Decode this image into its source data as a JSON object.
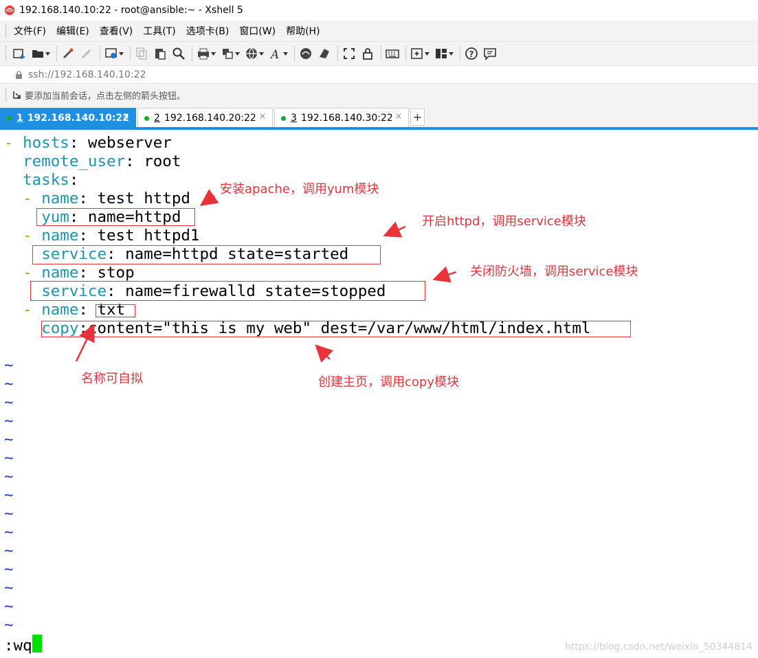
{
  "window": {
    "title": "192.168.140.10:22 - root@ansible:~ - Xshell 5"
  },
  "menu": [
    "文件(F)",
    "编辑(E)",
    "查看(V)",
    "工具(T)",
    "选项卡(B)",
    "窗口(W)",
    "帮助(H)"
  ],
  "toolbar": {
    "icons": [
      "new-session-icon",
      "open-folder-icon",
      "connect-icon",
      "disconnect-icon",
      "properties-icon",
      "copy-icon",
      "paste-icon",
      "find-icon",
      "print-icon",
      "transfer-icon",
      "globe-icon",
      "font-icon",
      "xftp-icon",
      "xmanager-icon",
      "fullscreen-icon",
      "lock-icon",
      "keyboard-icon",
      "add-tab-icon",
      "layout-icon",
      "help-icon",
      "chat-icon"
    ]
  },
  "address": {
    "text": "ssh://192.168.140.10:22"
  },
  "session_hint": {
    "text": "要添加当前会话，点击左侧的箭头按钮。"
  },
  "tabs": [
    {
      "num": "1",
      "label": "192.168.140.10:22",
      "active": true
    },
    {
      "num": "2",
      "label": "192.168.140.20:22",
      "active": false
    },
    {
      "num": "3",
      "label": "192.168.140.30:22",
      "active": false
    }
  ],
  "colors": {
    "accent": "#1e8fe1",
    "keyword": "#1a95b0",
    "dash": "#b5a21d",
    "annotation": "#e8333a",
    "tilde": "#1a3cbf",
    "cursor": "#00e000",
    "status_dot": "#0fae1e"
  },
  "editor": {
    "lines": [
      {
        "dash": "- ",
        "key": "hosts",
        "colon": ": ",
        "value": "webserver"
      },
      {
        "dash": "",
        "key": "remote_user",
        "colon": ": ",
        "value": "root"
      },
      {
        "dash": "",
        "key": "tasks",
        "colon": ":",
        "value": ""
      },
      {
        "dash": "- ",
        "key": "name",
        "colon": ": ",
        "value": "test httpd"
      },
      {
        "dash": "",
        "key": "yum",
        "colon": ": ",
        "value": "name=httpd"
      },
      {
        "dash": "- ",
        "key": "name",
        "colon": ": ",
        "value": "test httpd1"
      },
      {
        "dash": "",
        "key": "service",
        "colon": ": ",
        "value": "name=httpd state=started"
      },
      {
        "dash": "- ",
        "key": "name",
        "colon": ": ",
        "value": "stop"
      },
      {
        "dash": "",
        "key": "service",
        "colon": ": ",
        "value": "name=firewalld state=stopped"
      },
      {
        "dash": "- ",
        "key": "name",
        "colon": ": ",
        "value": "txt"
      },
      {
        "dash": "",
        "key": "copy",
        "colon": ":",
        "value": "content=\"this is my web\" dest=/var/www/html/index.html"
      }
    ],
    "tilde": "~",
    "command": ":wq"
  },
  "annotations": {
    "a1": "安装apache，调用yum模块",
    "a2": "开启httpd，调用service模块",
    "a3": "关闭防火墙，调用service模块",
    "a4": "名称可自拟",
    "a5": "创建主页，调用copy模块"
  },
  "watermark": "https://blog.csdn.net/weixin_50344814"
}
